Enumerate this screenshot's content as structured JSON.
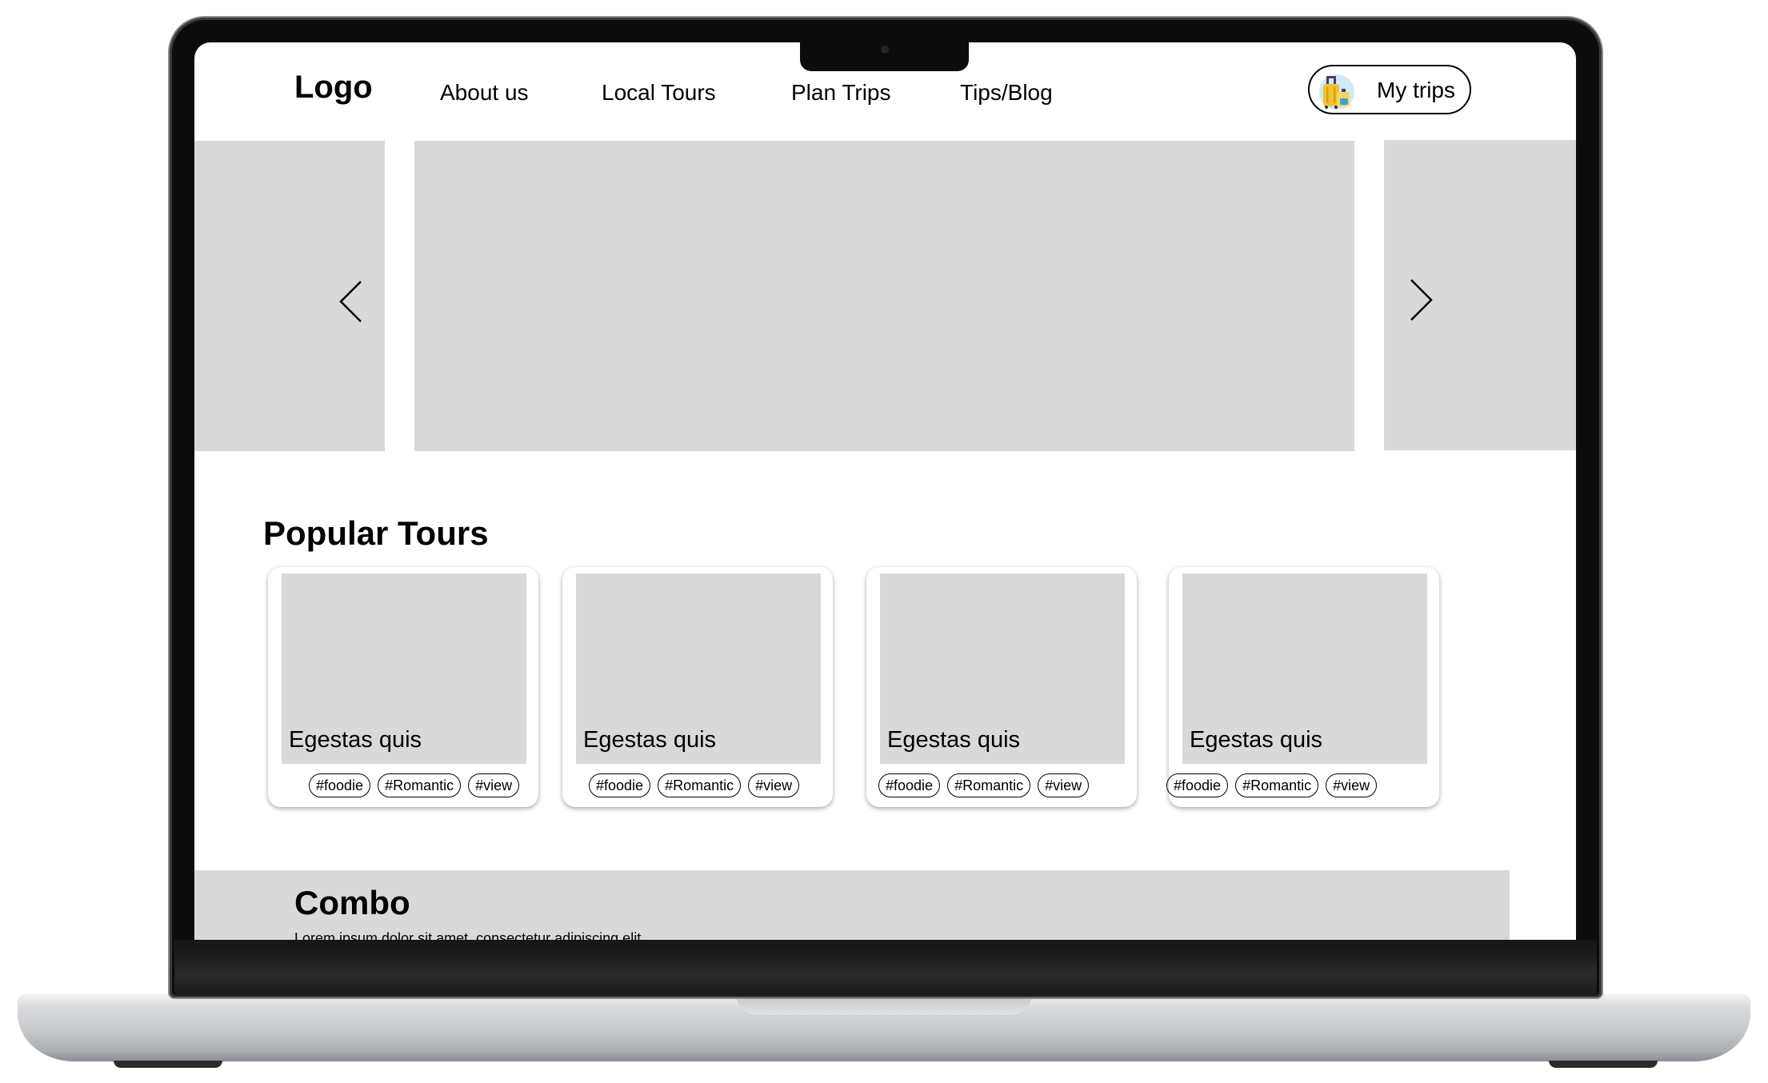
{
  "header": {
    "logo": "Logo",
    "nav": [
      {
        "label": "About us"
      },
      {
        "label": "Local Tours"
      },
      {
        "label": "Plan Trips"
      },
      {
        "label": "Tips/Blog"
      }
    ],
    "my_trips_label": "My trips",
    "my_trips_icon": "luggage-icon"
  },
  "carousel": {
    "prev_icon": "chevron-left-icon",
    "next_icon": "chevron-right-icon"
  },
  "popular": {
    "title": "Popular Tours",
    "cards": [
      {
        "title": "Egestas quis",
        "tags": [
          "#foodie",
          "#Romantic",
          "#view"
        ]
      },
      {
        "title": "Egestas quis",
        "tags": [
          "#foodie",
          "#Romantic",
          "#view"
        ]
      },
      {
        "title": "Egestas quis",
        "tags": [
          "#foodie",
          "#Romantic",
          "#view"
        ]
      },
      {
        "title": "Egestas quis",
        "tags": [
          "#foodie",
          "#Romantic",
          "#view"
        ]
      }
    ]
  },
  "combo": {
    "title": "Combo",
    "description": "Lorem ipsum dolor sit amet, consectetur adipiscing elit"
  },
  "colors": {
    "placeholder": "#d9d9d9",
    "text": "#000000",
    "bezel": "#0c0c0c"
  }
}
